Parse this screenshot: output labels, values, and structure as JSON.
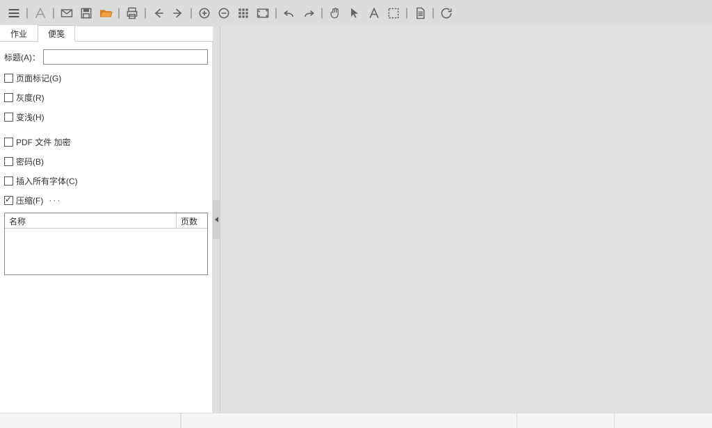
{
  "toolbar": {
    "icons": [
      "menu-icon",
      "sep",
      "pdf-icon",
      "sep",
      "mail-icon",
      "save-icon",
      "open-folder-icon",
      "sep",
      "print-icon",
      "sep",
      "back-icon",
      "forward-icon",
      "sep",
      "zoom-in-icon",
      "zoom-out-icon",
      "grid-icon",
      "fit-icon",
      "sep",
      "undo-icon",
      "redo-icon",
      "sep",
      "hand-icon",
      "pointer-icon",
      "text-icon",
      "select-area-icon",
      "sep",
      "document-icon",
      "sep",
      "refresh-icon"
    ],
    "active_icon": "open-folder-icon"
  },
  "tabs": {
    "items": [
      "作业",
      "便笺"
    ],
    "active_index": 1
  },
  "panel": {
    "title_label": "标题(A)：",
    "title_value": "",
    "checkboxes": [
      {
        "label": "页面标记(G)",
        "checked": false
      },
      {
        "label": "灰度(R)",
        "checked": false
      },
      {
        "label": "变浅(H)",
        "checked": false
      }
    ],
    "checkboxes2": [
      {
        "label": "PDF 文件 加密",
        "checked": false
      },
      {
        "label": "密码(B)",
        "checked": false
      },
      {
        "label": "插入所有字体(C)",
        "checked": false
      },
      {
        "label": "压缩(F)",
        "checked": true,
        "ellipsis": true
      }
    ],
    "table": {
      "col_name": "名称",
      "col_pages": "页数"
    }
  }
}
